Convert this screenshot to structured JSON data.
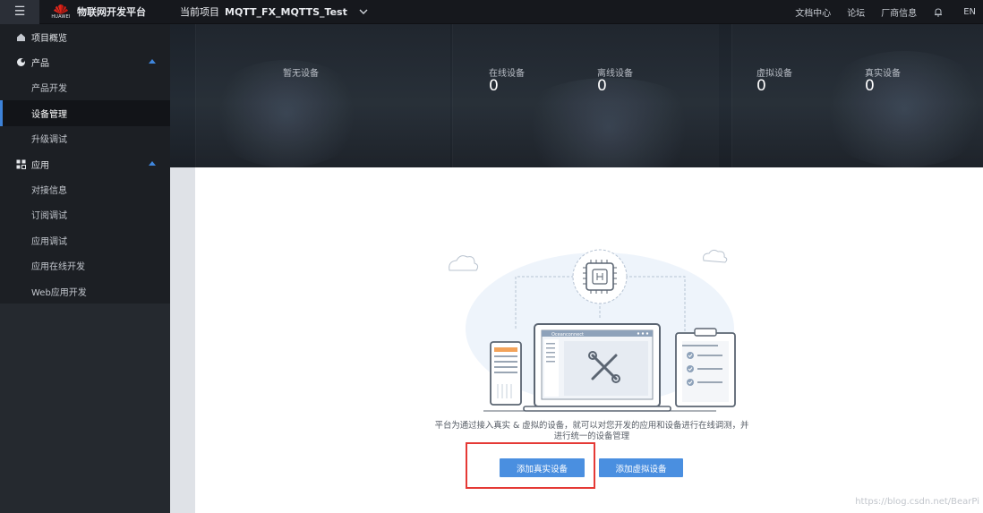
{
  "topbar": {
    "brand_small": "HUAWEI",
    "platform_title": "物联网开发平台",
    "project_label": "当前项目",
    "project_name": "MQTT_FX_MQTTS_Test",
    "nav": [
      "文档中心",
      "论坛",
      "厂商信息"
    ],
    "lang": "EN",
    "icons": {
      "menu": "hamburger-icon",
      "dropdown": "chevron-down-icon",
      "bell": "bell-icon"
    }
  },
  "sidebar": {
    "items": [
      {
        "label": "项目概览",
        "level": "top",
        "icon": "home-icon"
      },
      {
        "label": "产品",
        "level": "top",
        "icon": "product-icon",
        "expanded": true
      },
      {
        "label": "产品开发",
        "level": "sub"
      },
      {
        "label": "设备管理",
        "level": "sub",
        "active": true
      },
      {
        "label": "升级调试",
        "level": "sub"
      },
      {
        "label": "应用",
        "level": "top",
        "icon": "grid-icon",
        "expanded": true
      },
      {
        "label": "对接信息",
        "level": "sub"
      },
      {
        "label": "订阅调试",
        "level": "sub"
      },
      {
        "label": "应用调试",
        "level": "sub"
      },
      {
        "label": "应用在线开发",
        "level": "sub"
      },
      {
        "label": "Web应用开发",
        "level": "sub"
      }
    ]
  },
  "stats": {
    "no_device": "暂无设备",
    "online": {
      "label": "在线设备",
      "value": "0"
    },
    "offline": {
      "label": "离线设备",
      "value": "0"
    },
    "virtual": {
      "label": "虚拟设备",
      "value": "0"
    },
    "real": {
      "label": "真实设备",
      "value": "0"
    }
  },
  "empty_state": {
    "window_title": "Oceanconnect",
    "description_line1": "平台为通过接入真实 & 虚拟的设备，就可以对您开发的应用和设备进行在线调测，并",
    "description_line2": "进行统一的设备管理",
    "add_real_button": "添加真实设备",
    "add_virtual_button": "添加虚拟设备"
  },
  "watermark": "https://blog.csdn.net/BearPi",
  "colors": {
    "accent": "#4a8fe0",
    "highlight_box": "#e53935",
    "sidebar_bg": "#25292f",
    "topbar_bg": "#16181d"
  }
}
